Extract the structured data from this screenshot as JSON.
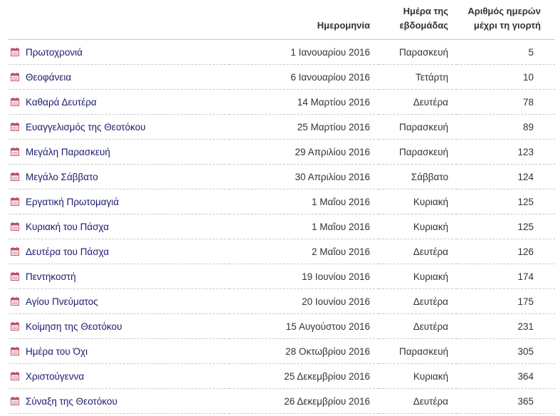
{
  "table": {
    "headers": {
      "date": "Ημερομηνία",
      "weekday_line1": "Ημέρα της",
      "weekday_line2": "εβδομάδας",
      "days_line1": "Αριθμός ημερών",
      "days_line2": "μέχρι τη γιορτή"
    },
    "icon": "calendar-icon",
    "colors": {
      "icon": "#c0506a",
      "link": "#1a1a6e",
      "divider": "#c8c8c8"
    },
    "rows": [
      {
        "name": "Πρωτοχρονιά",
        "date": "1 Ιανουαρίου 2016",
        "weekday": "Παρασκευή",
        "days": "5"
      },
      {
        "name": "Θεοφάνεια",
        "date": "6 Ιανουαρίου 2016",
        "weekday": "Τετάρτη",
        "days": "10"
      },
      {
        "name": "Καθαρά Δευτέρα",
        "date": "14 Μαρτίου 2016",
        "weekday": "Δευτέρα",
        "days": "78"
      },
      {
        "name": "Ευαγγελισμός της Θεοτόκου",
        "date": "25 Μαρτίου 2016",
        "weekday": "Παρασκευή",
        "days": "89"
      },
      {
        "name": "Μεγάλη Παρασκευή",
        "date": "29 Απριλίου 2016",
        "weekday": "Παρασκευή",
        "days": "123"
      },
      {
        "name": "Μεγάλο Σάββατο",
        "date": "30 Απριλίου 2016",
        "weekday": "Σάββατο",
        "days": "124"
      },
      {
        "name": "Εργατική Πρωτομαγιά",
        "date": "1 Μαΐου 2016",
        "weekday": "Κυριακή",
        "days": "125"
      },
      {
        "name": "Κυριακή του Πάσχα",
        "date": "1 Μαΐου 2016",
        "weekday": "Κυριακή",
        "days": "125"
      },
      {
        "name": "Δευτέρα του Πάσχα",
        "date": "2 Μαΐου 2016",
        "weekday": "Δευτέρα",
        "days": "126"
      },
      {
        "name": "Πεντηκοστή",
        "date": "19 Ιουνίου 2016",
        "weekday": "Κυριακή",
        "days": "174"
      },
      {
        "name": "Αγίου Πνεύματος",
        "date": "20 Ιουνίου 2016",
        "weekday": "Δευτέρα",
        "days": "175"
      },
      {
        "name": "Κοίμηση της Θεοτόκου",
        "date": "15 Αυγούστου 2016",
        "weekday": "Δευτέρα",
        "days": "231"
      },
      {
        "name": "Ημέρα του Όχι",
        "date": "28 Οκτωβρίου 2016",
        "weekday": "Παρασκευή",
        "days": "305"
      },
      {
        "name": "Χριστούγεννα",
        "date": "25 Δεκεμβρίου 2016",
        "weekday": "Κυριακή",
        "days": "364"
      },
      {
        "name": "Σύναξη της Θεοτόκου",
        "date": "26 Δεκεμβρίου 2016",
        "weekday": "Δευτέρα",
        "days": "365"
      }
    ]
  }
}
